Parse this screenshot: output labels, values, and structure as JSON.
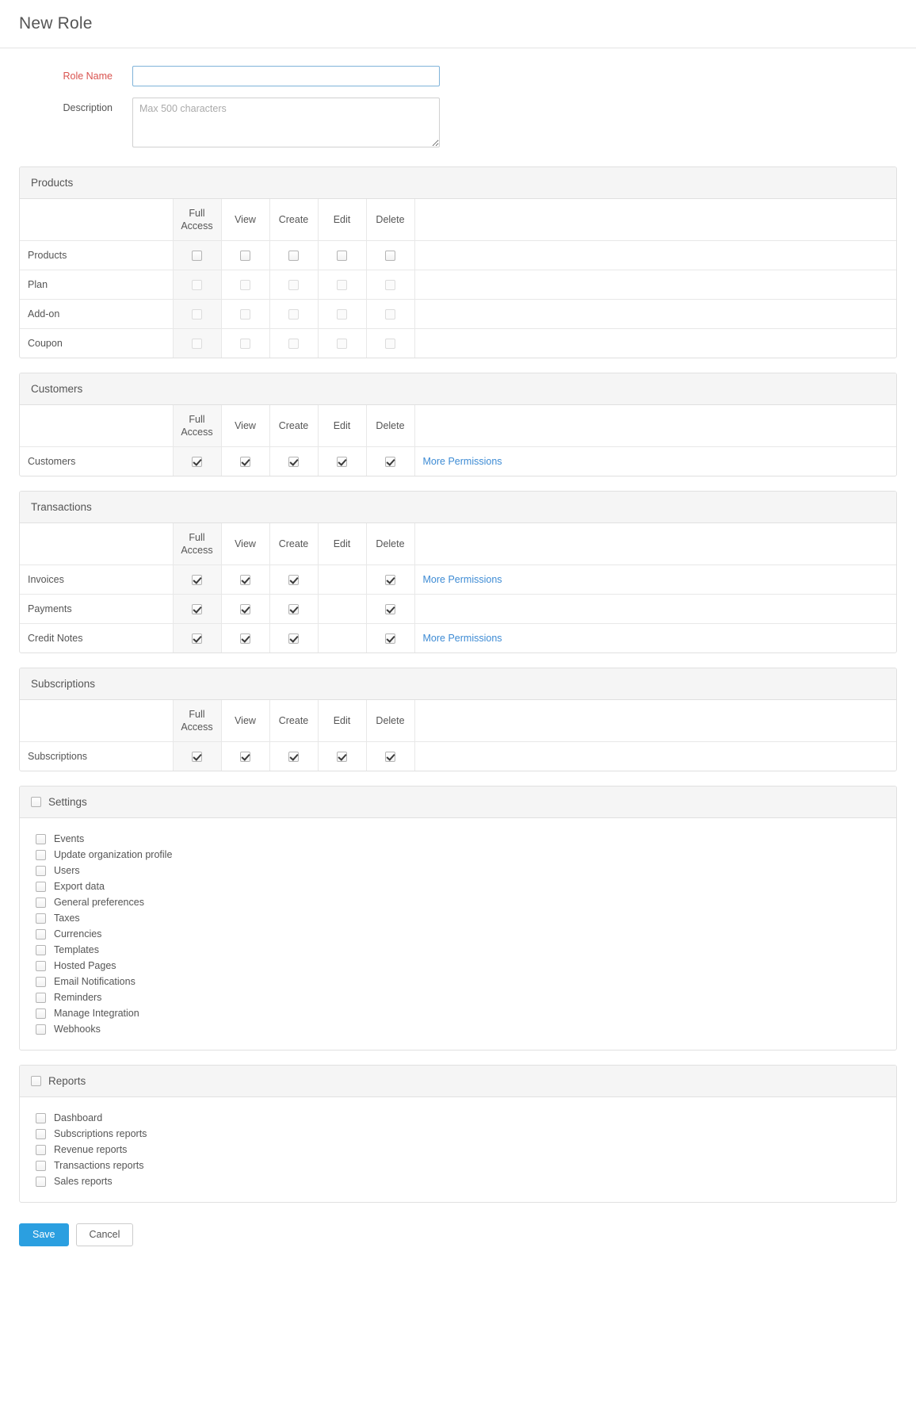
{
  "header": {
    "title": "New Role"
  },
  "form": {
    "role_name": {
      "label": "Role Name",
      "value": "",
      "placeholder": ""
    },
    "description": {
      "label": "Description",
      "value": "",
      "placeholder": "Max 500 characters"
    }
  },
  "permission_columns": [
    "Full Access",
    "View",
    "Create",
    "Edit",
    "Delete"
  ],
  "more_permissions_label": "More Permissions",
  "sections": [
    {
      "title": "Products",
      "type": "table",
      "rows": [
        {
          "name": "Products",
          "checks": [
            false,
            false,
            false,
            false,
            false
          ],
          "enabled": [
            true,
            true,
            true,
            true,
            true
          ],
          "more": false
        },
        {
          "name": "Plan",
          "checks": [
            false,
            false,
            false,
            false,
            false
          ],
          "enabled": [
            false,
            false,
            false,
            false,
            false
          ],
          "more": false
        },
        {
          "name": "Add-on",
          "checks": [
            false,
            false,
            false,
            false,
            false
          ],
          "enabled": [
            false,
            false,
            false,
            false,
            false
          ],
          "more": false
        },
        {
          "name": "Coupon",
          "checks": [
            false,
            false,
            false,
            false,
            false
          ],
          "enabled": [
            false,
            false,
            false,
            false,
            false
          ],
          "more": false
        }
      ]
    },
    {
      "title": "Customers",
      "type": "table",
      "rows": [
        {
          "name": "Customers",
          "checks": [
            true,
            true,
            true,
            true,
            true
          ],
          "enabled": [
            true,
            true,
            true,
            true,
            true
          ],
          "more": true
        }
      ]
    },
    {
      "title": "Transactions",
      "type": "table",
      "rows": [
        {
          "name": "Invoices",
          "checks": [
            true,
            true,
            true,
            null,
            true
          ],
          "enabled": [
            true,
            true,
            true,
            null,
            true
          ],
          "more": true
        },
        {
          "name": "Payments",
          "checks": [
            true,
            true,
            true,
            null,
            true
          ],
          "enabled": [
            true,
            true,
            true,
            null,
            true
          ],
          "more": false
        },
        {
          "name": "Credit Notes",
          "checks": [
            true,
            true,
            true,
            null,
            true
          ],
          "enabled": [
            true,
            true,
            true,
            null,
            true
          ],
          "more": true
        }
      ]
    },
    {
      "title": "Subscriptions",
      "type": "table",
      "rows": [
        {
          "name": "Subscriptions",
          "checks": [
            true,
            true,
            true,
            true,
            true
          ],
          "enabled": [
            true,
            true,
            true,
            true,
            true
          ],
          "more": false
        }
      ]
    },
    {
      "title": "Settings",
      "type": "list",
      "header_checkbox": true,
      "header_checked": false,
      "items": [
        {
          "label": "Events",
          "checked": false
        },
        {
          "label": "Update organization profile",
          "checked": false
        },
        {
          "label": "Users",
          "checked": false
        },
        {
          "label": "Export data",
          "checked": false
        },
        {
          "label": "General preferences",
          "checked": false
        },
        {
          "label": "Taxes",
          "checked": false
        },
        {
          "label": "Currencies",
          "checked": false
        },
        {
          "label": "Templates",
          "checked": false
        },
        {
          "label": "Hosted Pages",
          "checked": false
        },
        {
          "label": "Email Notifications",
          "checked": false
        },
        {
          "label": "Reminders",
          "checked": false
        },
        {
          "label": "Manage Integration",
          "checked": false
        },
        {
          "label": "Webhooks",
          "checked": false
        }
      ]
    },
    {
      "title": "Reports",
      "type": "list",
      "header_checkbox": true,
      "header_checked": false,
      "items": [
        {
          "label": "Dashboard",
          "checked": false
        },
        {
          "label": "Subscriptions reports",
          "checked": false
        },
        {
          "label": "Revenue reports",
          "checked": false
        },
        {
          "label": "Transactions reports",
          "checked": false
        },
        {
          "label": "Sales reports",
          "checked": false
        }
      ]
    }
  ],
  "footer": {
    "save_label": "Save",
    "cancel_label": "Cancel"
  },
  "colors": {
    "accent": "#2b9fe0",
    "link": "#3d8bd4",
    "required": "#d9534f"
  }
}
